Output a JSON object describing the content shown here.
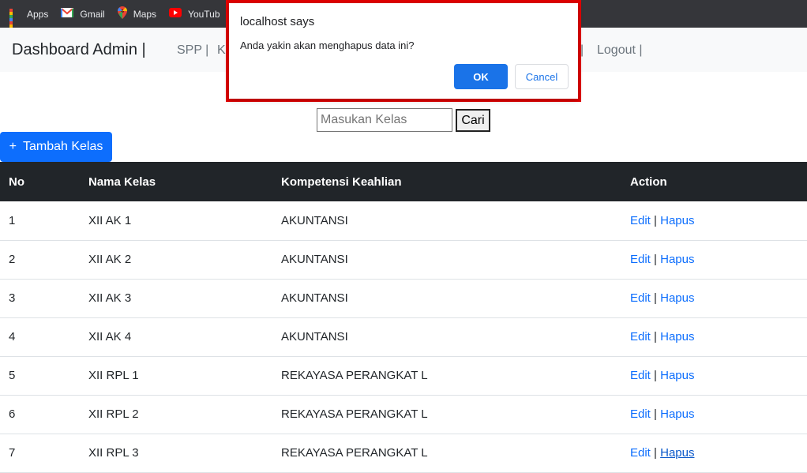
{
  "bookmarks": [
    {
      "label": "Apps",
      "icon": "apps-grid-icon"
    },
    {
      "label": "Gmail",
      "icon": "gmail-icon"
    },
    {
      "label": "Maps",
      "icon": "maps-pin-icon"
    },
    {
      "label": "YouTub",
      "icon": "youtube-icon"
    }
  ],
  "navbar": {
    "brand": "Dashboard Admin |",
    "spp": "SPP |",
    "k": "K",
    "sep": "|",
    "logout": "Logout |"
  },
  "search": {
    "placeholder": "Masukan Kelas",
    "button": "Cari"
  },
  "add_button": {
    "icon": "+",
    "label": "Tambah Kelas"
  },
  "table": {
    "headers": [
      "No",
      "Nama Kelas",
      "Kompetensi Keahlian",
      "Action"
    ],
    "rows": [
      {
        "no": "1",
        "nama": "XII AK 1",
        "kompetensi": "AKUNTANSI"
      },
      {
        "no": "2",
        "nama": "XII AK 2",
        "kompetensi": "AKUNTANSI"
      },
      {
        "no": "3",
        "nama": "XII AK 3",
        "kompetensi": "AKUNTANSI"
      },
      {
        "no": "4",
        "nama": "XII AK 4",
        "kompetensi": "AKUNTANSI"
      },
      {
        "no": "5",
        "nama": "XII RPL 1",
        "kompetensi": "REKAYASA PERANGKAT L"
      },
      {
        "no": "6",
        "nama": "XII RPL 2",
        "kompetensi": "REKAYASA PERANGKAT L"
      },
      {
        "no": "7",
        "nama": "XII RPL 3",
        "kompetensi": "REKAYASA PERANGKAT L"
      }
    ],
    "edit_label": "Edit",
    "separator": "|",
    "hapus_label": "Hapus"
  },
  "dialog": {
    "title": "localhost says",
    "message": "Anda yakin akan menghapus data ini?",
    "ok": "OK",
    "cancel": "Cancel"
  },
  "colors": {
    "primary": "#0d6efd",
    "dialog_ok": "#1a73e8",
    "highlight_border": "#e00000",
    "table_header": "#212529"
  }
}
